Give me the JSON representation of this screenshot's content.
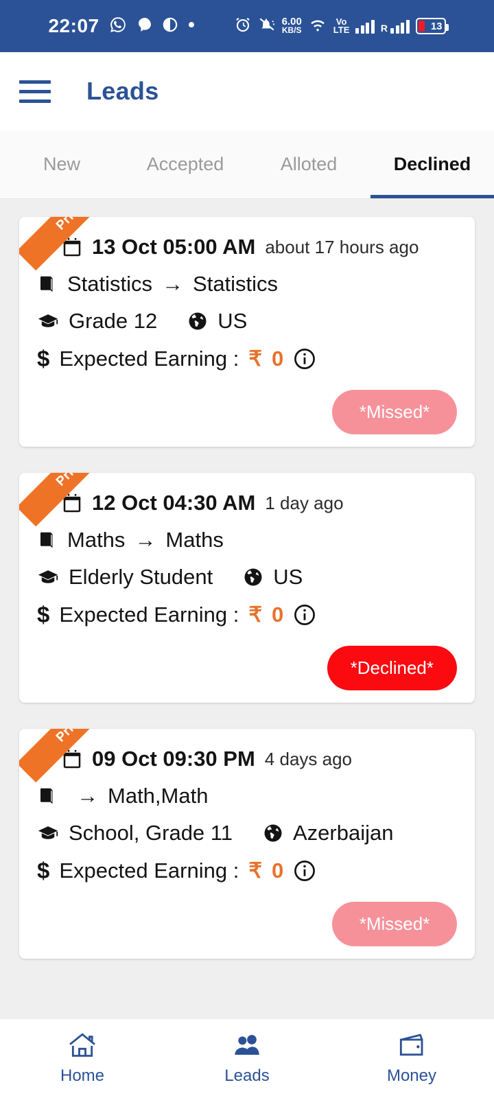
{
  "colors": {
    "brand_blue": "#2b5296",
    "accent_orange": "#ee7326",
    "earning_orange": "#e8722b",
    "missed_pink": "#f6919a",
    "declined_red": "#fb0a10",
    "page_bg": "#efefef"
  },
  "status_bar": {
    "time": "22:07",
    "icons_left": [
      "whatsapp-icon",
      "chat-bubble-icon",
      "contrast-icon",
      "dot-icon"
    ],
    "alarm_icon": "alarm-clock-icon",
    "mute_icon": "bell-muted-icon",
    "net_speed_value": "6.00",
    "net_speed_unit": "KB/S",
    "wifi_icon": "wifi-icon",
    "volte_top": "Vo",
    "volte_bottom": "LTE",
    "signal_icon": "signal-bars-icon",
    "roaming_label": "R",
    "battery_percent": "13"
  },
  "app_bar": {
    "menu_icon": "hamburger-menu-icon",
    "title": "Leads"
  },
  "tabs": [
    {
      "label": "New",
      "active": false
    },
    {
      "label": "Accepted",
      "active": false
    },
    {
      "label": "Alloted",
      "active": false
    },
    {
      "label": "Declined",
      "active": true
    }
  ],
  "leads": [
    {
      "ribbon": "Prime",
      "date": "13 Oct 05:00 AM",
      "relative_time": "about 17 hours ago",
      "subject_from": "Statistics",
      "subject_arrow": "→",
      "subject_to": "Statistics",
      "grade": "Grade 12",
      "country": "US",
      "earning_label": "Expected Earning :",
      "earning_currency": "₹",
      "earning_amount": "0",
      "info_icon": "info-circle-icon",
      "status_label": "*Missed*",
      "status_kind": "missed"
    },
    {
      "ribbon": "Prime",
      "date": "12 Oct 04:30 AM",
      "relative_time": "1 day ago",
      "subject_from": "Maths",
      "subject_arrow": "→",
      "subject_to": "Maths",
      "grade": "Elderly Student",
      "country": "US",
      "earning_label": "Expected Earning :",
      "earning_currency": "₹",
      "earning_amount": "0",
      "info_icon": "info-circle-icon",
      "status_label": "*Declined*",
      "status_kind": "declined"
    },
    {
      "ribbon": "Prime",
      "date": "09 Oct 09:30 PM",
      "relative_time": "4 days ago",
      "subject_from": "",
      "subject_arrow": "→",
      "subject_to": "Math,Math",
      "grade": "School, Grade 11",
      "country": "Azerbaijan",
      "earning_label": "Expected Earning :",
      "earning_currency": "₹",
      "earning_amount": "0",
      "info_icon": "info-circle-icon",
      "status_label": "*Missed*",
      "status_kind": "missed"
    }
  ],
  "bottom_nav": [
    {
      "label": "Home",
      "icon": "home-icon"
    },
    {
      "label": "Leads",
      "icon": "people-icon"
    },
    {
      "label": "Money",
      "icon": "wallet-icon"
    }
  ]
}
